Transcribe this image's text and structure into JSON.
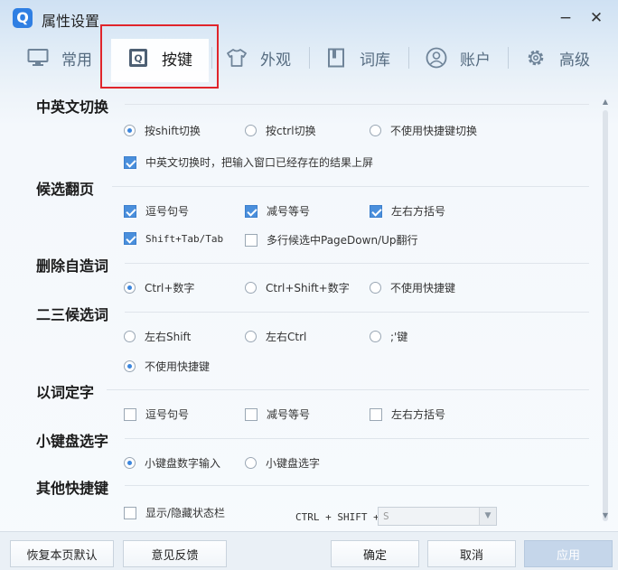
{
  "window": {
    "logo_letter": "Q",
    "title": "属性设置",
    "minimize": "−",
    "close": "✕"
  },
  "tabs": [
    {
      "label": "常用",
      "icon": "monitor-icon"
    },
    {
      "label": "按键",
      "icon": "keyboard-q-icon",
      "active": true
    },
    {
      "label": "外观",
      "icon": "tshirt-icon"
    },
    {
      "label": "词库",
      "icon": "book-icon"
    },
    {
      "label": "账户",
      "icon": "user-icon"
    },
    {
      "label": "高级",
      "icon": "gear-icon"
    }
  ],
  "sections": {
    "switch": {
      "title": "中英文切换",
      "options": [
        "按shift切换",
        "按ctrl切换",
        "不使用快捷键切换"
      ],
      "selected": 0,
      "commit_check": "中英文切换时，把输入窗口已经存在的结果上屏",
      "commit_checked": true
    },
    "paging": {
      "title": "候选翻页",
      "options": [
        "逗号句号",
        "减号等号",
        "左右方括号",
        "Shift+Tab/Tab",
        "多行候选中PageDown/Up翻行"
      ],
      "checked": [
        true,
        true,
        true,
        true,
        false
      ]
    },
    "delete": {
      "title": "删除自造词",
      "options": [
        "Ctrl+数字",
        "Ctrl+Shift+数字",
        "不使用快捷键"
      ],
      "selected": 0
    },
    "second_third": {
      "title": "二三候选词",
      "options": [
        "左右Shift",
        "左右Ctrl",
        ";'键",
        "不使用快捷键"
      ],
      "selected": 3
    },
    "word_char": {
      "title": "以词定字",
      "options": [
        "逗号句号",
        "减号等号",
        "左右方括号"
      ],
      "checked": [
        false,
        false,
        false
      ]
    },
    "numpad": {
      "title": "小键盘选字",
      "options": [
        "小键盘数字输入",
        "小键盘选字"
      ],
      "selected": 0
    },
    "other": {
      "title": "其他快捷键",
      "status_bar_label": "显示/隐藏状态栏",
      "status_bar_checked": false,
      "combo_prefix": "CTRL + SHIFT +",
      "combo_value": "S"
    }
  },
  "footer": {
    "restore": "恢复本页默认",
    "feedback": "意见反馈",
    "ok": "确定",
    "cancel": "取消",
    "apply": "应用"
  },
  "colors": {
    "accent": "#3b86dd",
    "highlight_outline": "#e0252b",
    "logo": "#2f7fe3"
  }
}
